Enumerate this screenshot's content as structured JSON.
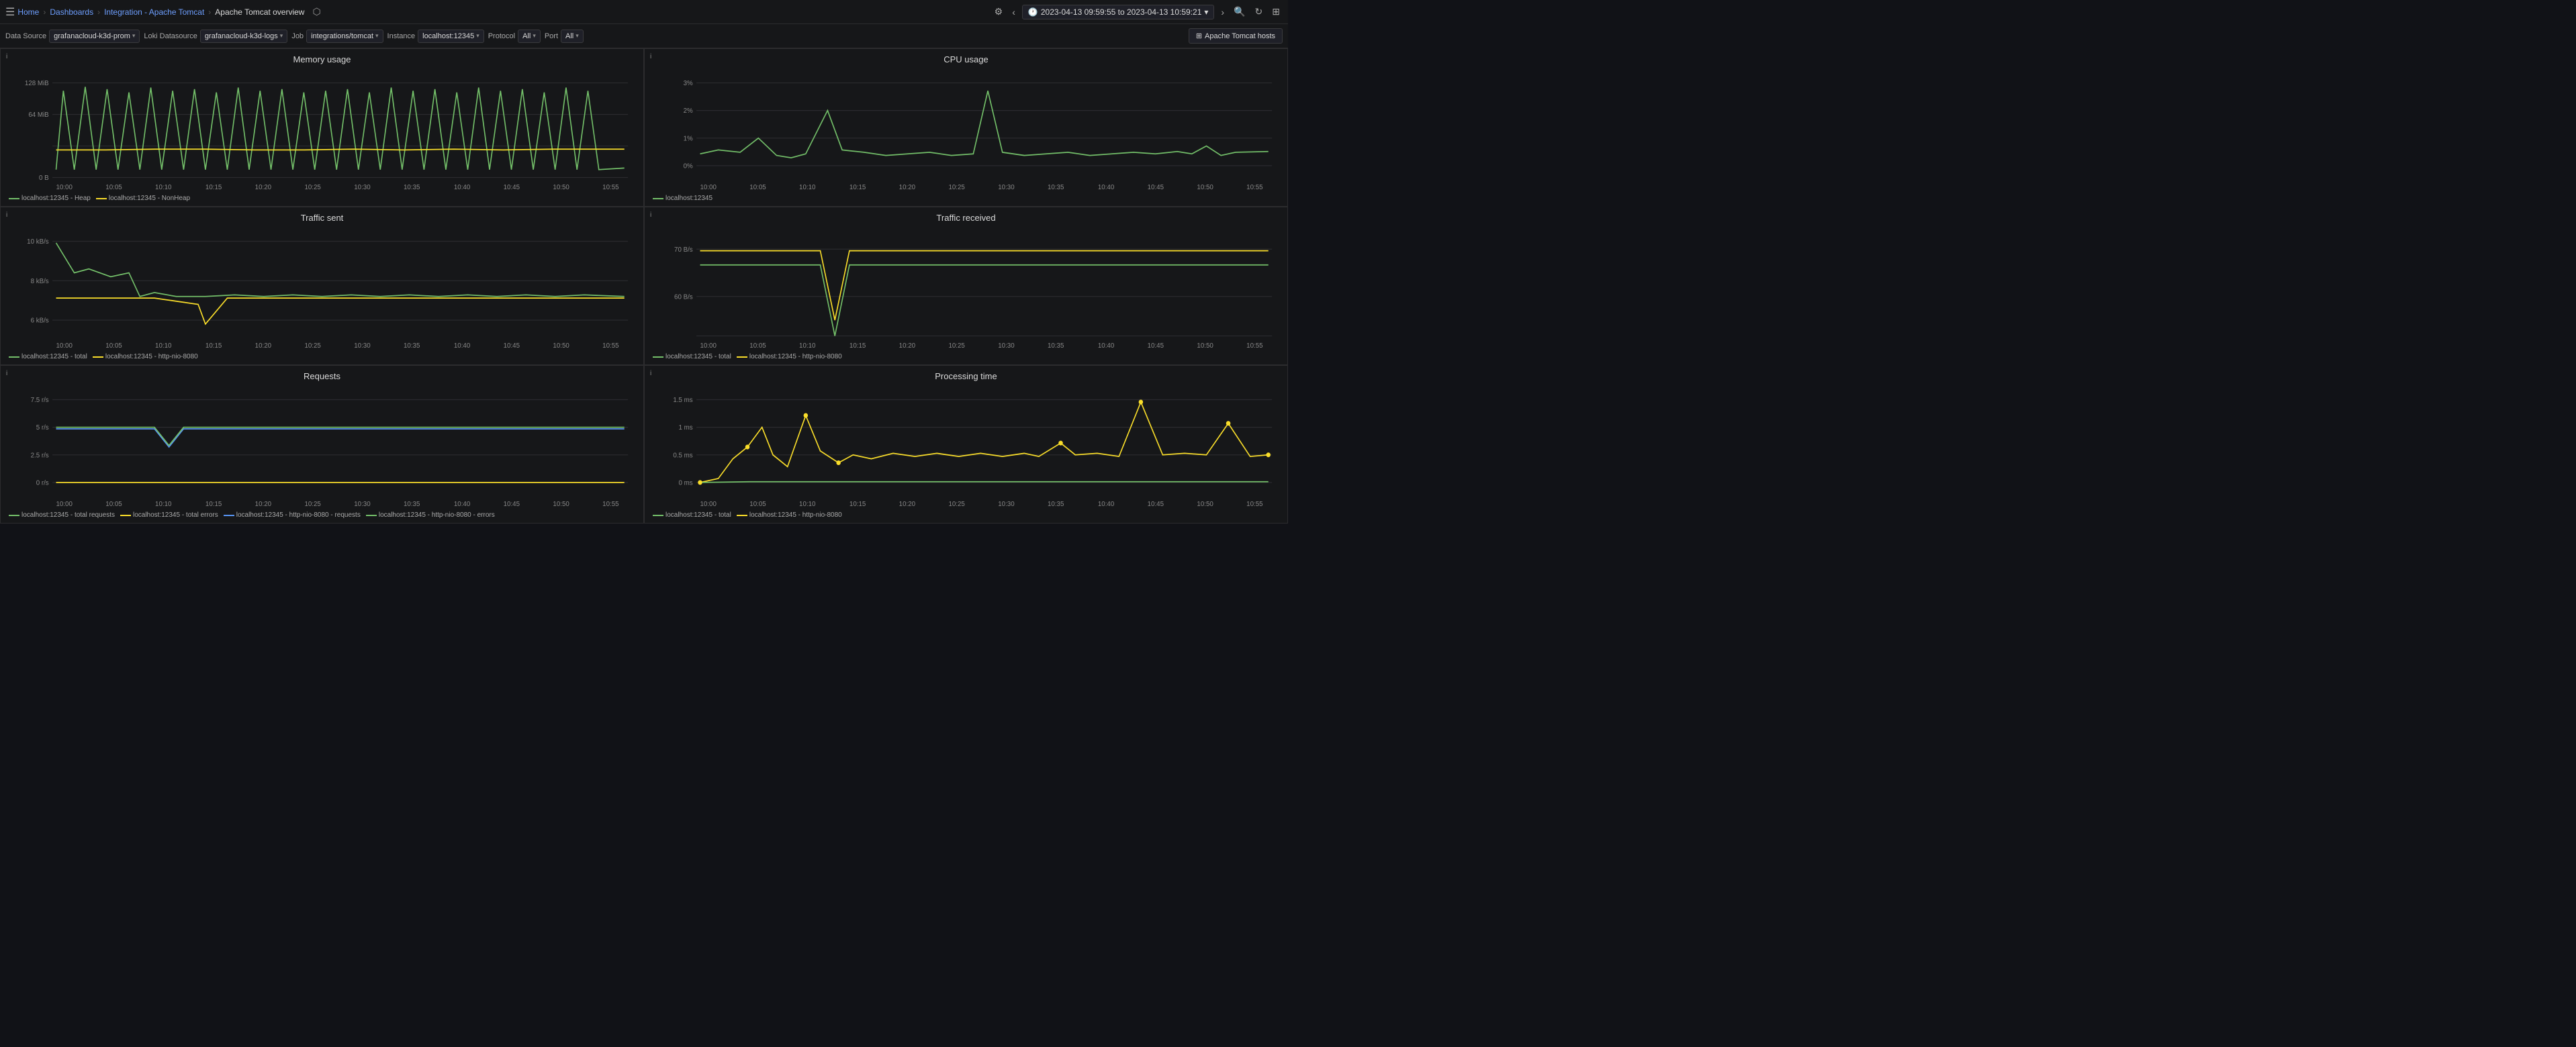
{
  "topbar": {
    "menu_icon": "☰",
    "home": "Home",
    "dashboards": "Dashboards",
    "integration": "Integration - Apache Tomcat",
    "page_title": "Apache Tomcat overview",
    "share_icon": "⬡",
    "settings_icon": "⚙",
    "time_range": "2023-04-13 09:59:55 to 2023-04-13 10:59:21",
    "prev_icon": "‹",
    "next_icon": "›",
    "zoom_icon": "🔍",
    "refresh_icon": "↻",
    "expand_icon": "⊞"
  },
  "toolbar": {
    "data_source_label": "Data Source",
    "data_source_value": "grafanacloud-k3d-prom",
    "loki_label": "Loki Datasource",
    "loki_value": "grafanacloud-k3d-logs",
    "job_label": "Job",
    "job_value": "integrations/tomcat",
    "instance_label": "Instance",
    "instance_value": "localhost:12345",
    "protocol_label": "Protocol",
    "protocol_value": "All",
    "port_label": "Port",
    "port_value": "All",
    "apache_btn": "Apache Tomcat hosts"
  },
  "panels": {
    "memory_usage": {
      "title": "Memory usage",
      "y_labels": [
        "128 MiB",
        "64 MiB",
        "0 B"
      ],
      "x_labels": [
        "10:00",
        "10:05",
        "10:10",
        "10:15",
        "10:20",
        "10:25",
        "10:30",
        "10:35",
        "10:40",
        "10:45",
        "10:50",
        "10:55"
      ],
      "legend": [
        {
          "label": "localhost:12345 - Heap",
          "color": "#73bf69"
        },
        {
          "label": "localhost:12345 - NonHeap",
          "color": "#fade2a"
        }
      ]
    },
    "cpu_usage": {
      "title": "CPU usage",
      "y_labels": [
        "3%",
        "2%",
        "1%",
        "0%"
      ],
      "x_labels": [
        "10:00",
        "10:05",
        "10:10",
        "10:15",
        "10:20",
        "10:25",
        "10:30",
        "10:35",
        "10:40",
        "10:45",
        "10:50",
        "10:55"
      ],
      "legend": [
        {
          "label": "localhost:12345",
          "color": "#73bf69"
        }
      ]
    },
    "traffic_sent": {
      "title": "Traffic sent",
      "y_labels": [
        "10 kB/s",
        "8 kB/s",
        "6 kB/s"
      ],
      "x_labels": [
        "10:00",
        "10:05",
        "10:10",
        "10:15",
        "10:20",
        "10:25",
        "10:30",
        "10:35",
        "10:40",
        "10:45",
        "10:50",
        "10:55"
      ],
      "legend": [
        {
          "label": "localhost:12345 - total",
          "color": "#73bf69"
        },
        {
          "label": "localhost:12345 - http-nio-8080",
          "color": "#fade2a"
        }
      ]
    },
    "traffic_received": {
      "title": "Traffic received",
      "y_labels": [
        "70 B/s",
        "60 B/s"
      ],
      "x_labels": [
        "10:00",
        "10:05",
        "10:10",
        "10:15",
        "10:20",
        "10:25",
        "10:30",
        "10:35",
        "10:40",
        "10:45",
        "10:50",
        "10:55"
      ],
      "legend": [
        {
          "label": "localhost:12345 - total",
          "color": "#73bf69"
        },
        {
          "label": "localhost:12345 - http-nio-8080",
          "color": "#fade2a"
        }
      ]
    },
    "requests": {
      "title": "Requests",
      "y_labels": [
        "7.5 r/s",
        "5 r/s",
        "2.5 r/s",
        "0 r/s"
      ],
      "x_labels": [
        "10:00",
        "10:05",
        "10:10",
        "10:15",
        "10:20",
        "10:25",
        "10:30",
        "10:35",
        "10:40",
        "10:45",
        "10:50",
        "10:55"
      ],
      "legend": [
        {
          "label": "localhost:12345 - total requests",
          "color": "#73bf69"
        },
        {
          "label": "localhost:12345 - total errors",
          "color": "#fade2a"
        },
        {
          "label": "localhost:12345 - http-nio-8080 - requests",
          "color": "#5794f2"
        },
        {
          "label": "localhost:12345 - http-nio-8080 - errors",
          "color": "#73bf69"
        }
      ]
    },
    "processing_time": {
      "title": "Processing time",
      "y_labels": [
        "1.5 ms",
        "1 ms",
        "0.5 ms",
        "0 ms"
      ],
      "x_labels": [
        "10:00",
        "10:05",
        "10:10",
        "10:15",
        "10:20",
        "10:25",
        "10:30",
        "10:35",
        "10:40",
        "10:45",
        "10:50",
        "10:55"
      ],
      "legend": [
        {
          "label": "localhost:12345 - total",
          "color": "#73bf69"
        },
        {
          "label": "localhost:12345 - http-nio-8080",
          "color": "#fade2a"
        }
      ]
    }
  }
}
